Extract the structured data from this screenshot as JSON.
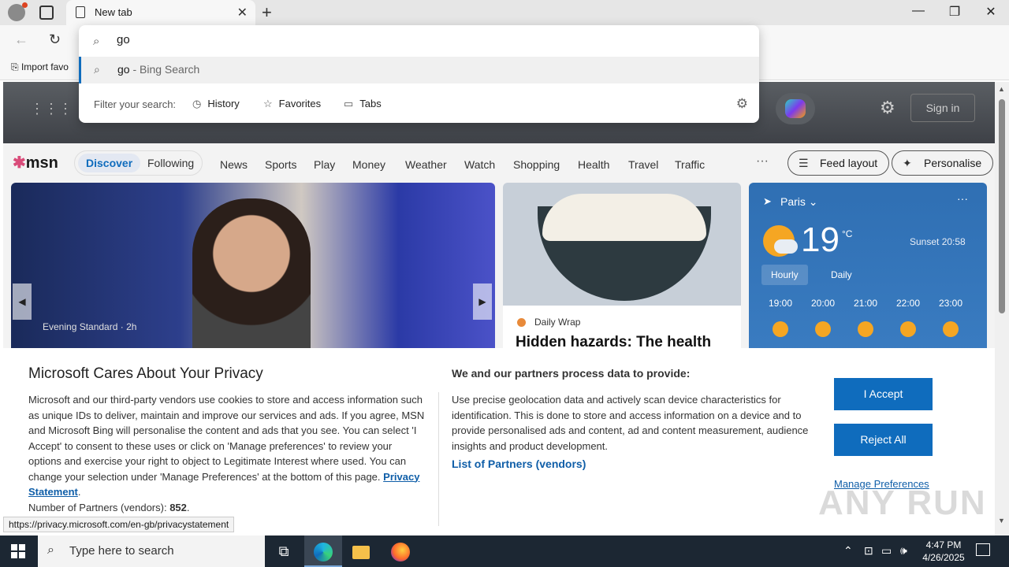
{
  "browser": {
    "tab_title": "New tab",
    "address_value": "go",
    "suggestion_query": "go",
    "suggestion_suffix": " - Bing Search",
    "filter_label": "Filter your search:",
    "filters": [
      "History",
      "Favorites",
      "Tabs"
    ],
    "favbar_item": "Import favo"
  },
  "page": {
    "signin_label": "Sign in",
    "msn_logo": "msn",
    "pill_discover": "Discover",
    "pill_following": "Following",
    "nav": [
      "News",
      "Sports",
      "Play",
      "Money",
      "Weather",
      "Watch",
      "Shopping",
      "Health",
      "Travel",
      "Traffic"
    ],
    "more": "···",
    "feed_layout": "Feed layout",
    "personalise": "Personalise",
    "card1_source": "Evening Standard · 2h",
    "card2_source": "Daily Wrap",
    "card2_title": "Hidden hazards: The health",
    "weather": {
      "location": "Paris",
      "temp": "19",
      "unit": "°C",
      "sunset": "Sunset 20:58",
      "tabs": [
        "Hourly",
        "Daily"
      ],
      "hours": [
        "19:00",
        "20:00",
        "21:00",
        "22:00",
        "23:00"
      ]
    }
  },
  "privacy": {
    "title": "Microsoft Cares About Your Privacy",
    "body": "Microsoft and our third-party vendors use cookies to store and access information such as unique IDs to deliver, maintain and improve our services and ads. If you agree, MSN and Microsoft Bing will personalise the content and ads that you see. You can select 'I Accept' to consent to these uses or click on 'Manage preferences' to review your options and exercise your right to object to Legitimate Interest where used. You can change your selection under 'Manage Preferences' at the bottom of this page.",
    "statement_link": "Privacy Statement",
    "partners_label": "Number of Partners (vendors):",
    "partners_count": "852",
    "heading2": "We and our partners process data to provide:",
    "body2": "Use precise geolocation data and actively scan device characteristics for identification. This is done to store and access information on a device and to provide personalised ads and content, ad and content measurement, audience insights and product development.",
    "partners_link": "List of Partners (vendors)",
    "accept": "I Accept",
    "reject": "Reject All",
    "manage": "Manage Preferences"
  },
  "status_url": "https://privacy.microsoft.com/en-gb/privacystatement",
  "watermark": "ANY RUN",
  "taskbar": {
    "search_placeholder": "Type here to search",
    "time": "4:47 PM",
    "date": "4/26/2025"
  },
  "colors": {
    "accent": "#0f6cbd",
    "link": "#0f5ea8",
    "taskbar": "#1c2733"
  }
}
